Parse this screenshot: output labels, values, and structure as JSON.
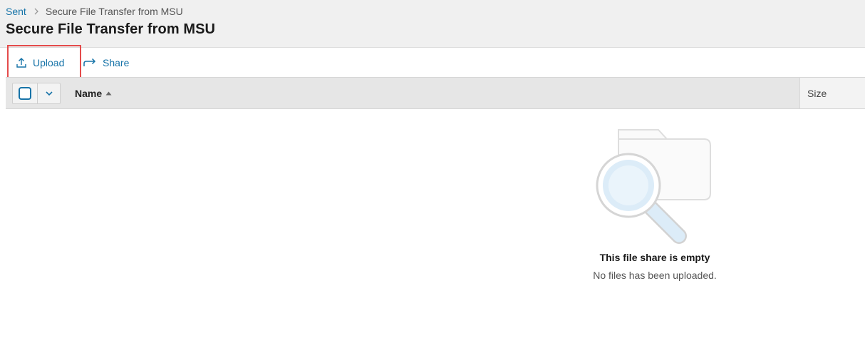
{
  "breadcrumb": {
    "root": "Sent",
    "current": "Secure File Transfer from MSU"
  },
  "page": {
    "title": "Secure File Transfer from MSU"
  },
  "toolbar": {
    "upload_label": "Upload",
    "share_label": "Share"
  },
  "table": {
    "columns": {
      "name": "Name",
      "size": "Size"
    },
    "sort": "name-ascending",
    "select_all_checked": false
  },
  "empty_state": {
    "title": "This file share is empty",
    "message": "No files has been uploaded."
  },
  "colors": {
    "accent": "#1673a8",
    "highlight": "#e44b4b",
    "header_bg": "#f0f0f0"
  },
  "icons": {
    "upload": "upload-icon",
    "share": "share-arrow-icon",
    "breadcrumb_separator": "chevron-right-icon",
    "select_dropdown": "chevron-down-icon",
    "sort": "sort-ascending-icon",
    "empty": "folder-search-illustration"
  }
}
